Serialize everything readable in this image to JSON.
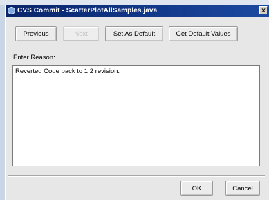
{
  "window": {
    "title": "CVS Commit - ScatterPlotAllSamples.java",
    "close_glyph": "x",
    "icon": "cvs-app-icon"
  },
  "toolbar": {
    "previous_label": "Previous",
    "next_label": "Next",
    "set_default_label": "Set As Default",
    "get_default_label": "Get Default Values"
  },
  "reason": {
    "label": "Enter Reason:",
    "text": "Reverted Code back to 1.2 revision."
  },
  "footer": {
    "ok_label": "OK",
    "cancel_label": "Cancel"
  }
}
